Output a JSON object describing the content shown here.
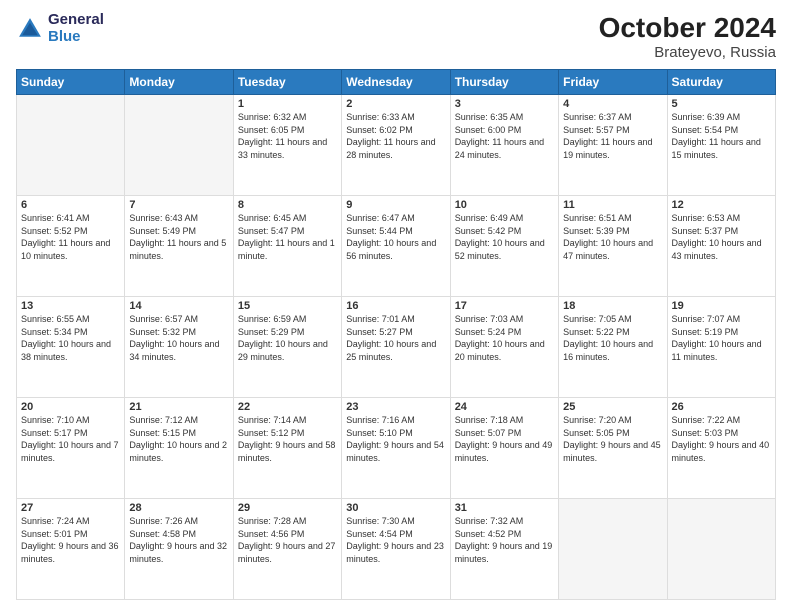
{
  "header": {
    "logo_line1": "General",
    "logo_line2": "Blue",
    "main_title": "October 2024",
    "subtitle": "Brateyevo, Russia"
  },
  "days_of_week": [
    "Sunday",
    "Monday",
    "Tuesday",
    "Wednesday",
    "Thursday",
    "Friday",
    "Saturday"
  ],
  "weeks": [
    [
      {
        "day": "",
        "info": ""
      },
      {
        "day": "",
        "info": ""
      },
      {
        "day": "1",
        "info": "Sunrise: 6:32 AM\nSunset: 6:05 PM\nDaylight: 11 hours and 33 minutes."
      },
      {
        "day": "2",
        "info": "Sunrise: 6:33 AM\nSunset: 6:02 PM\nDaylight: 11 hours and 28 minutes."
      },
      {
        "day": "3",
        "info": "Sunrise: 6:35 AM\nSunset: 6:00 PM\nDaylight: 11 hours and 24 minutes."
      },
      {
        "day": "4",
        "info": "Sunrise: 6:37 AM\nSunset: 5:57 PM\nDaylight: 11 hours and 19 minutes."
      },
      {
        "day": "5",
        "info": "Sunrise: 6:39 AM\nSunset: 5:54 PM\nDaylight: 11 hours and 15 minutes."
      }
    ],
    [
      {
        "day": "6",
        "info": "Sunrise: 6:41 AM\nSunset: 5:52 PM\nDaylight: 11 hours and 10 minutes."
      },
      {
        "day": "7",
        "info": "Sunrise: 6:43 AM\nSunset: 5:49 PM\nDaylight: 11 hours and 5 minutes."
      },
      {
        "day": "8",
        "info": "Sunrise: 6:45 AM\nSunset: 5:47 PM\nDaylight: 11 hours and 1 minute."
      },
      {
        "day": "9",
        "info": "Sunrise: 6:47 AM\nSunset: 5:44 PM\nDaylight: 10 hours and 56 minutes."
      },
      {
        "day": "10",
        "info": "Sunrise: 6:49 AM\nSunset: 5:42 PM\nDaylight: 10 hours and 52 minutes."
      },
      {
        "day": "11",
        "info": "Sunrise: 6:51 AM\nSunset: 5:39 PM\nDaylight: 10 hours and 47 minutes."
      },
      {
        "day": "12",
        "info": "Sunrise: 6:53 AM\nSunset: 5:37 PM\nDaylight: 10 hours and 43 minutes."
      }
    ],
    [
      {
        "day": "13",
        "info": "Sunrise: 6:55 AM\nSunset: 5:34 PM\nDaylight: 10 hours and 38 minutes."
      },
      {
        "day": "14",
        "info": "Sunrise: 6:57 AM\nSunset: 5:32 PM\nDaylight: 10 hours and 34 minutes."
      },
      {
        "day": "15",
        "info": "Sunrise: 6:59 AM\nSunset: 5:29 PM\nDaylight: 10 hours and 29 minutes."
      },
      {
        "day": "16",
        "info": "Sunrise: 7:01 AM\nSunset: 5:27 PM\nDaylight: 10 hours and 25 minutes."
      },
      {
        "day": "17",
        "info": "Sunrise: 7:03 AM\nSunset: 5:24 PM\nDaylight: 10 hours and 20 minutes."
      },
      {
        "day": "18",
        "info": "Sunrise: 7:05 AM\nSunset: 5:22 PM\nDaylight: 10 hours and 16 minutes."
      },
      {
        "day": "19",
        "info": "Sunrise: 7:07 AM\nSunset: 5:19 PM\nDaylight: 10 hours and 11 minutes."
      }
    ],
    [
      {
        "day": "20",
        "info": "Sunrise: 7:10 AM\nSunset: 5:17 PM\nDaylight: 10 hours and 7 minutes."
      },
      {
        "day": "21",
        "info": "Sunrise: 7:12 AM\nSunset: 5:15 PM\nDaylight: 10 hours and 2 minutes."
      },
      {
        "day": "22",
        "info": "Sunrise: 7:14 AM\nSunset: 5:12 PM\nDaylight: 9 hours and 58 minutes."
      },
      {
        "day": "23",
        "info": "Sunrise: 7:16 AM\nSunset: 5:10 PM\nDaylight: 9 hours and 54 minutes."
      },
      {
        "day": "24",
        "info": "Sunrise: 7:18 AM\nSunset: 5:07 PM\nDaylight: 9 hours and 49 minutes."
      },
      {
        "day": "25",
        "info": "Sunrise: 7:20 AM\nSunset: 5:05 PM\nDaylight: 9 hours and 45 minutes."
      },
      {
        "day": "26",
        "info": "Sunrise: 7:22 AM\nSunset: 5:03 PM\nDaylight: 9 hours and 40 minutes."
      }
    ],
    [
      {
        "day": "27",
        "info": "Sunrise: 7:24 AM\nSunset: 5:01 PM\nDaylight: 9 hours and 36 minutes."
      },
      {
        "day": "28",
        "info": "Sunrise: 7:26 AM\nSunset: 4:58 PM\nDaylight: 9 hours and 32 minutes."
      },
      {
        "day": "29",
        "info": "Sunrise: 7:28 AM\nSunset: 4:56 PM\nDaylight: 9 hours and 27 minutes."
      },
      {
        "day": "30",
        "info": "Sunrise: 7:30 AM\nSunset: 4:54 PM\nDaylight: 9 hours and 23 minutes."
      },
      {
        "day": "31",
        "info": "Sunrise: 7:32 AM\nSunset: 4:52 PM\nDaylight: 9 hours and 19 minutes."
      },
      {
        "day": "",
        "info": ""
      },
      {
        "day": "",
        "info": ""
      }
    ]
  ]
}
